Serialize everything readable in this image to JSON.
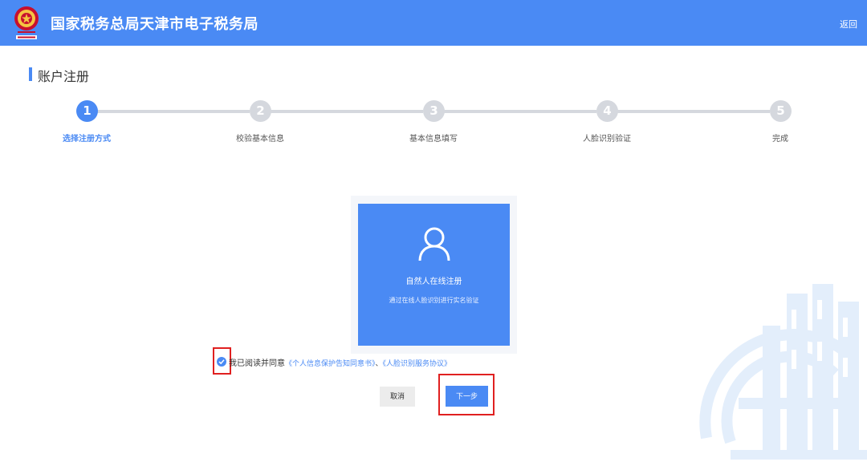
{
  "header": {
    "title": "国家税务总局天津市电子税务局",
    "back_label": "返回",
    "logo_caption": "中国税务"
  },
  "section": {
    "title": "账户注册"
  },
  "steps": [
    {
      "number": "1",
      "label": "选择注册方式",
      "active": true
    },
    {
      "number": "2",
      "label": "校验基本信息",
      "active": false
    },
    {
      "number": "3",
      "label": "基本信息填写",
      "active": false
    },
    {
      "number": "4",
      "label": "人脸识别验证",
      "active": false
    },
    {
      "number": "5",
      "label": "完成",
      "active": false
    }
  ],
  "card": {
    "icon": "user-icon",
    "title": "自然人在线注册",
    "description": "通过在线人脸识别进行实名验证"
  },
  "agreement": {
    "checked": true,
    "text": "我已阅读并同意",
    "link1": "《个人信息保护告知同意书》",
    "separator": "、",
    "link2": "《人脸识别服务协议》"
  },
  "buttons": {
    "cancel": "取消",
    "next": "下一步"
  },
  "colors": {
    "primary": "#4a8af4",
    "inactive_step": "#d5d8de",
    "highlight_outline": "#e02020"
  }
}
